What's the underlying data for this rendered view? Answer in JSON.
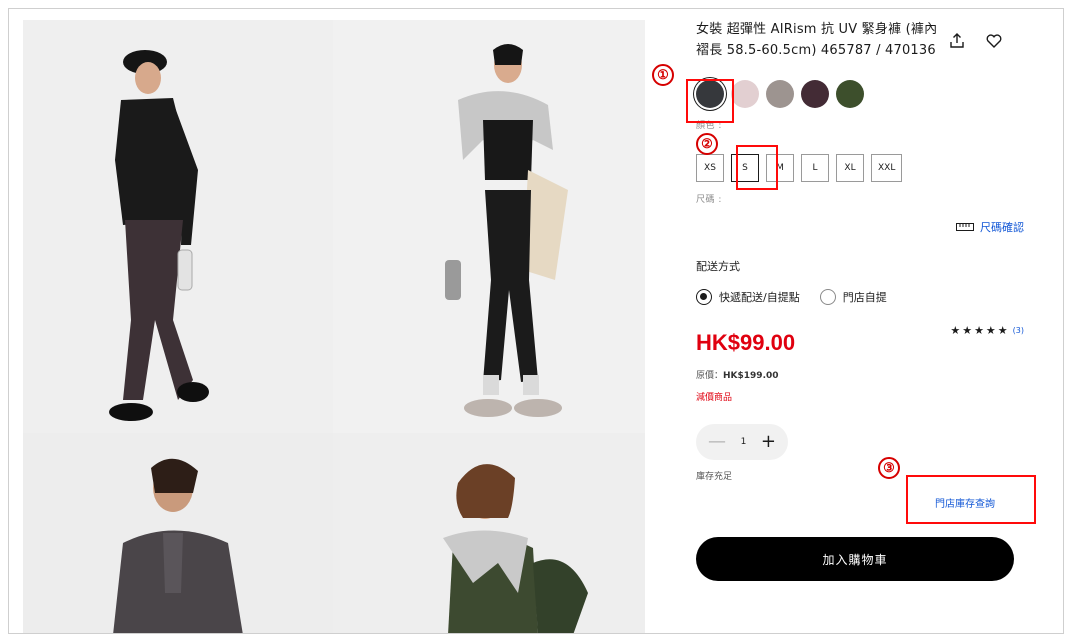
{
  "product": {
    "title": "女裝 超彈性 AIRism 抗 UV 緊身褲 (褲內褶長 58.5-60.5cm) 465787 / 470136",
    "colors": [
      "#36383c",
      "#e2cfd1",
      "#9d9490",
      "#432b35",
      "#3d4f2c"
    ],
    "color_label": "顏色 :",
    "sizes": [
      "XS",
      "S",
      "M",
      "L",
      "XL",
      "XXL"
    ],
    "size_label": "尺碼 :",
    "size_guide": "尺碼確認",
    "delivery_title": "配送方式",
    "delivery_options": [
      "快遞配送/自提點",
      "門店自提"
    ],
    "price": "HK$99.00",
    "stars": "★★★★★",
    "rating_count": "(3)",
    "original_price_label": "原價：",
    "original_price": "HK$199.00",
    "discount_label": "減價商品",
    "qty_minus": "—",
    "qty": "1",
    "qty_plus": "+",
    "stock_status": "庫存充足",
    "store_stock": "門店庫存查詢",
    "add_to_cart": "加入購物車"
  },
  "annotations": {
    "one": "①",
    "two": "②",
    "three": "③"
  }
}
